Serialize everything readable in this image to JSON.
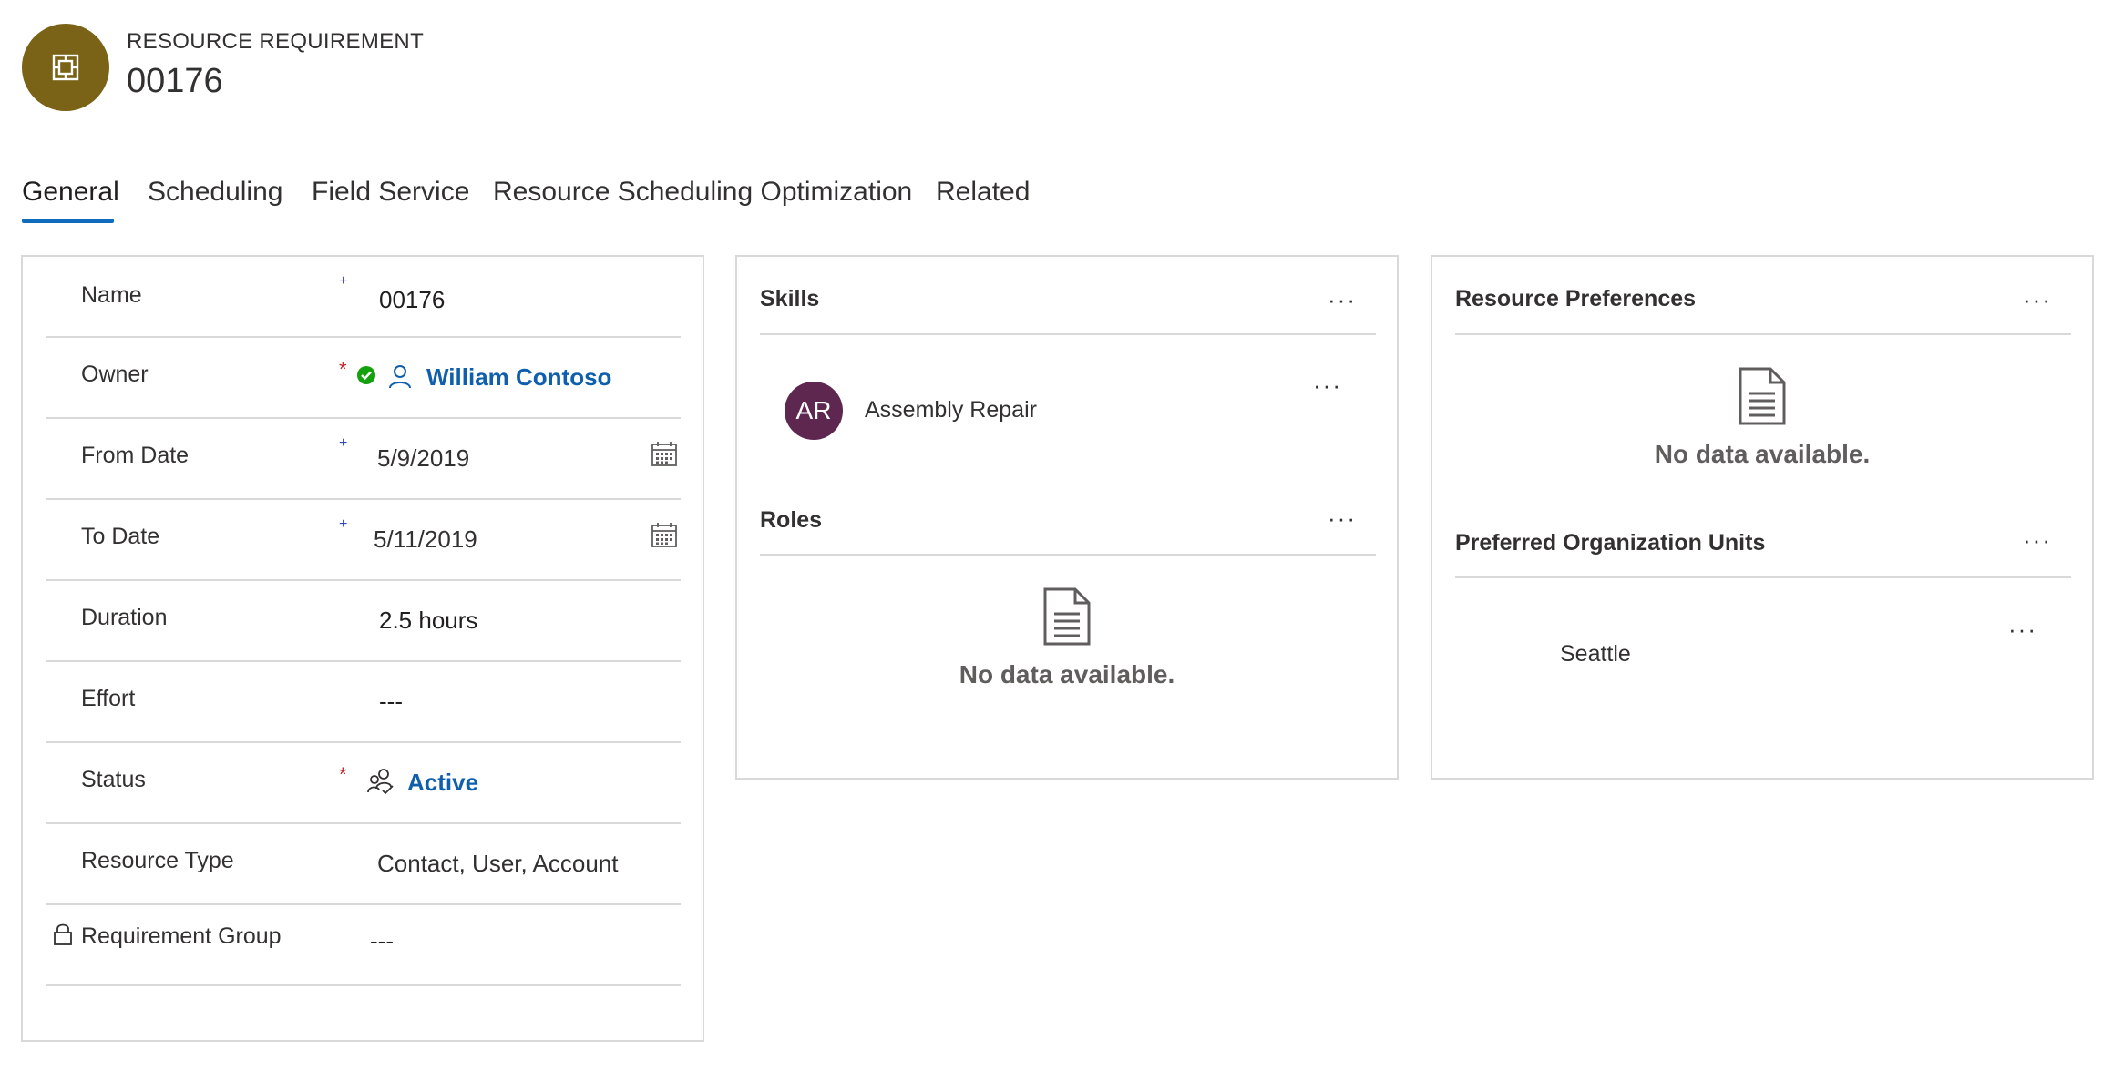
{
  "header": {
    "entity_type": "RESOURCE REQUIREMENT",
    "title": "00176",
    "icon": "puzzle-piece-icon"
  },
  "tabs": [
    {
      "label": "General",
      "active": true
    },
    {
      "label": "Scheduling",
      "active": false
    },
    {
      "label": "Field Service",
      "active": false
    },
    {
      "label": "Resource Scheduling Optimization",
      "active": false
    },
    {
      "label": "Related",
      "active": false
    }
  ],
  "general": {
    "fields": [
      {
        "label": "Name",
        "required": "+",
        "value": "00176"
      },
      {
        "label": "Owner",
        "required": "*",
        "value": "William Contoso"
      },
      {
        "label": "From Date",
        "required": "+",
        "value": "5/9/2019"
      },
      {
        "label": "To Date",
        "required": "+",
        "value": "5/11/2019"
      },
      {
        "label": "Duration",
        "required": "",
        "value": "2.5 hours"
      },
      {
        "label": "Effort",
        "required": "",
        "value": "---"
      },
      {
        "label": "Status",
        "required": "*",
        "value": "Active"
      },
      {
        "label": "Resource Type",
        "required": "",
        "value": "Contact, User, Account"
      },
      {
        "label": "Requirement Group",
        "required": "",
        "value": "---"
      }
    ]
  },
  "skills": {
    "title": "Skills",
    "more": "···",
    "items": [
      {
        "initials": "AR",
        "name": "Assembly Repair",
        "more": "···"
      }
    ]
  },
  "roles": {
    "title": "Roles",
    "more": "···",
    "empty": "No data available."
  },
  "resource_preferences": {
    "title": "Resource Preferences",
    "more": "···",
    "empty": "No data available."
  },
  "preferred_org_units": {
    "title": "Preferred Organization Units",
    "more": "···",
    "items": [
      {
        "name": "Seattle",
        "more": "···"
      }
    ]
  },
  "colors": {
    "accent": "#0f6cbd",
    "entity_icon_bg": "#7a6316",
    "avatar_bg": "#5e2750",
    "required_red": "#c4262e",
    "recommended_blue": "#2b46c5",
    "link": "#0f5fad",
    "presence_green": "#13a10e"
  }
}
